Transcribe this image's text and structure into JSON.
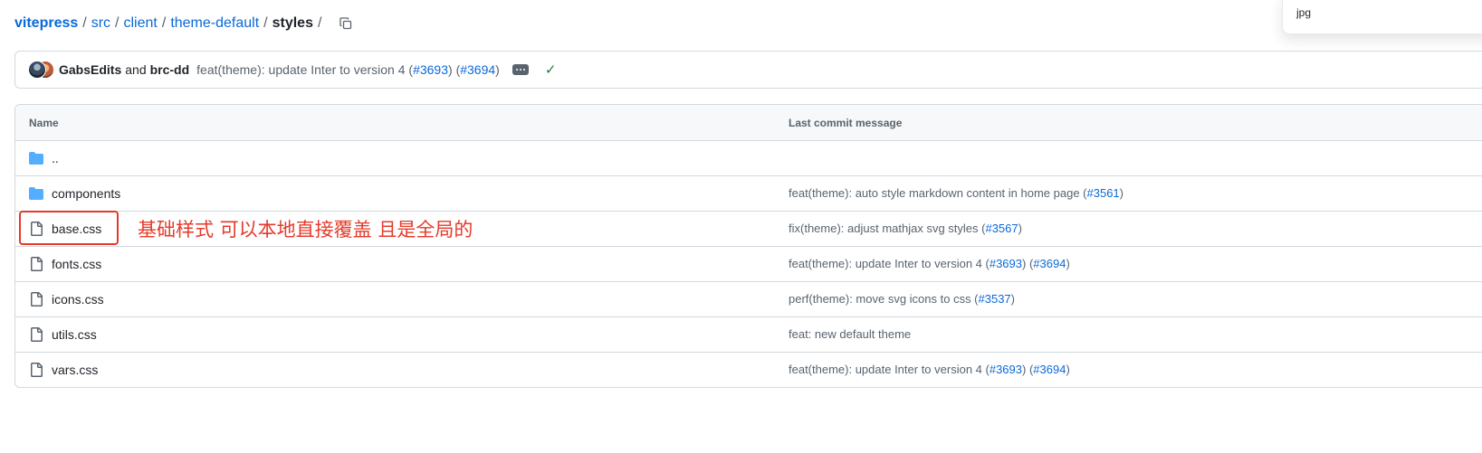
{
  "breadcrumb": {
    "root": "vitepress",
    "items": [
      "src",
      "client",
      "theme-default"
    ],
    "current": "styles",
    "separator": "/"
  },
  "popup": {
    "text": "jpg"
  },
  "commit": {
    "author1": "GabsEdits",
    "and": "and",
    "author2": "brc-dd",
    "message_prefix": "feat(theme): update Inter to version 4 (",
    "pr1": "#3693",
    "mid": ") (",
    "pr2": "#3694",
    "suffix": ")"
  },
  "table": {
    "headers": {
      "name": "Name",
      "message": "Last commit message"
    },
    "rows": [
      {
        "name": "..",
        "type": "folder",
        "msg": "",
        "links": []
      },
      {
        "name": "components",
        "type": "folder",
        "msg": "feat(theme): auto style markdown content in home page (",
        "links": [
          "#3561"
        ]
      },
      {
        "name": "base.css",
        "type": "file",
        "msg": "fix(theme): adjust mathjax svg styles (",
        "links": [
          "#3567"
        ]
      },
      {
        "name": "fonts.css",
        "type": "file",
        "msg": "feat(theme): update Inter to version 4 (",
        "links": [
          "#3693",
          "#3694"
        ]
      },
      {
        "name": "icons.css",
        "type": "file",
        "msg": "perf(theme): move svg icons to css (",
        "links": [
          "#3537"
        ]
      },
      {
        "name": "utils.css",
        "type": "file",
        "msg": "feat: new default theme",
        "links": []
      },
      {
        "name": "vars.css",
        "type": "file",
        "msg": "feat(theme): update Inter to version 4 (",
        "links": [
          "#3693",
          "#3694"
        ]
      }
    ]
  },
  "annotation": {
    "text": "基础样式 可以本地直接覆盖 且是全局的",
    "color": "#e53a2a"
  },
  "colors": {
    "link": "#0969da",
    "folder": "#54aeff",
    "muted": "#59636e",
    "border": "#d1d9e0",
    "success": "#1a7f37"
  },
  "icons": {
    "folder": "folder-icon",
    "file": "file-icon",
    "copy": "copy-icon",
    "check": "check-icon",
    "ellipsis": "ellipsis-icon"
  }
}
